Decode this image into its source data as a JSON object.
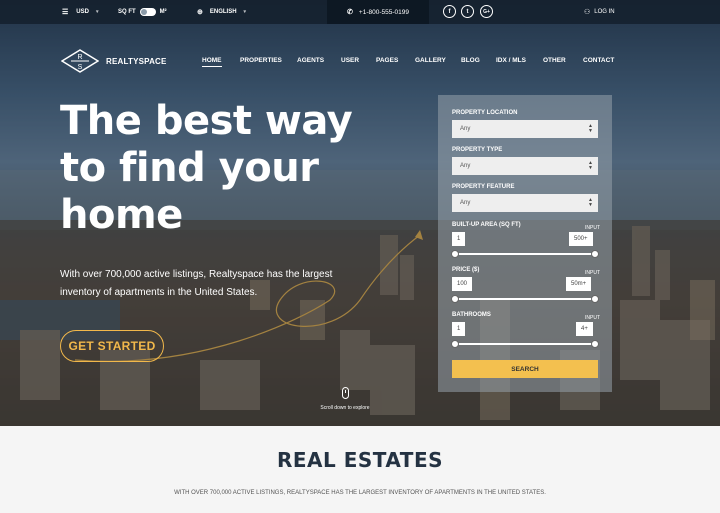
{
  "topbar": {
    "currency": "USD",
    "unit_left": "SQ FT",
    "unit_right": "M²",
    "language": "ENGLISH",
    "phone": "+1-800-555-0199",
    "social": [
      "facebook-icon",
      "twitter-icon",
      "google-plus-icon"
    ],
    "login": "LOG IN"
  },
  "logo": {
    "mark_top": "R",
    "mark_bottom": "S",
    "name": "REALTYSPACE"
  },
  "nav": [
    "HOME",
    "PROPERTIES",
    "AGENTS",
    "USER",
    "PAGES",
    "GALLERY",
    "BLOG",
    "IDX / MLS",
    "OTHER",
    "CONTACT"
  ],
  "hero": {
    "headline_1": "The best way",
    "headline_2": "to find your",
    "headline_3": "home",
    "subtext": "With over 700,000 active listings, Realtyspace has the largest inventory of apartments in the United States.",
    "cta": "GET STARTED",
    "scroll_hint": "Scroll down to explore"
  },
  "search": {
    "location_label": "PROPERTY LOCATION",
    "location_value": "Any",
    "type_label": "PROPERTY TYPE",
    "type_value": "Any",
    "feature_label": "PROPERTY FEATURE",
    "feature_value": "Any",
    "area_label": "BUILT-UP AREA (SQ FT)",
    "area_input_label": "INPUT",
    "area_min": "1",
    "area_max": "500+",
    "price_label": "PRICE ($)",
    "price_input_label": "INPUT",
    "price_min": "100",
    "price_max": "50m+",
    "bath_label": "BATHROOMS",
    "bath_input_label": "INPUT",
    "bath_min": "1",
    "bath_max": "4+",
    "button": "SEARCH"
  },
  "section": {
    "title": "REAL ESTATES",
    "subtitle": "WITH OVER 700,000 ACTIVE LISTINGS, REALTYSPACE HAS THE LARGEST INVENTORY OF APARTMENTS IN THE UNITED STATES."
  },
  "colors": {
    "accent": "#f3c04f",
    "dark": "#243242"
  }
}
